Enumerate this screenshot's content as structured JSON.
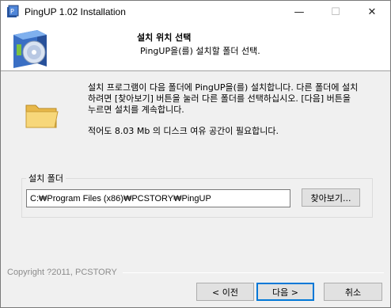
{
  "window": {
    "title": "PingUP 1.02 Installation",
    "minimize_glyph": "—",
    "maximize_glyph": "☐",
    "close_glyph": "✕"
  },
  "header": {
    "title": "설치 위치 선택",
    "subtitle": "PingUP을(를) 설치할 폴더 선택."
  },
  "body": {
    "description": "설치 프로그램이 다음 폴더에 PingUP을(를) 설치합니다. 다른 폴더에 설치\n하려면 [찾아보기] 버튼을 눌러 다른 폴더를 선택하십시오. [다음] 버튼을\n누르면 설치를 계속합니다.",
    "space_required": "적어도 8.03 Mb 의 디스크 여유 공간이 필요합니다."
  },
  "install_folder": {
    "group_label": "설치 폴더",
    "path_value": "C:₩Program Files (x86)₩PCSTORY₩PingUP",
    "browse_label": "찾아보기..."
  },
  "footer": {
    "copyright": "Copyright ?2011, PCSTORY",
    "back_label": "< 이전",
    "next_label": "다음 >",
    "cancel_label": "취소"
  },
  "icons": {
    "app": "installer-app-icon",
    "header": "install-disc-box-icon",
    "folder": "folder-icon"
  },
  "colors": {
    "accent": "#0078d7",
    "folder": "#f2c94c"
  }
}
